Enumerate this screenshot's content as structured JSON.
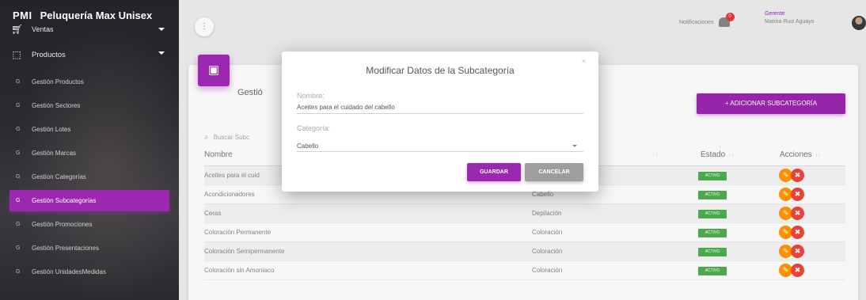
{
  "sidebar": {
    "logo": "PMI",
    "app_name": "Peluquería Max Unisex",
    "main_items": [
      {
        "label": "Ventas",
        "icon": "cart-icon"
      },
      {
        "label": "Productos",
        "icon": "basket-icon"
      }
    ],
    "sub_items": [
      {
        "marker": "G",
        "label": "Gestión Productos"
      },
      {
        "marker": "G",
        "label": "Gestión Sectores"
      },
      {
        "marker": "G",
        "label": "Gestión Lotes"
      },
      {
        "marker": "G",
        "label": "Gestión Marcas"
      },
      {
        "marker": "G",
        "label": "Gestion Categorías"
      },
      {
        "marker": "G",
        "label": "Gestión Subcategorías",
        "active": true
      },
      {
        "marker": "G",
        "label": "Gestión Promociones"
      },
      {
        "marker": "G",
        "label": "Gestión Presentaciones"
      },
      {
        "marker": "G",
        "label": "Gestión UnidadesMedidas"
      }
    ]
  },
  "topbar": {
    "menu_icon": "more-vert-icon",
    "notifications_label": "Notificaciones",
    "notifications_count": "0",
    "user_role": "Gerente",
    "user_name": "Marina Ruiz Aguayo"
  },
  "card": {
    "title": "Gestió",
    "add_button": "+ ADICIONAR SUBCATEGORÍA",
    "search_placeholder": "Buscar Subc"
  },
  "table": {
    "headers": {
      "name": "Nombre",
      "category": "↑↓",
      "status": "Estado",
      "actions": "Acciones"
    },
    "rows": [
      {
        "name": "Aceites para el cuid",
        "category": "",
        "status": "ACTIVO"
      },
      {
        "name": "Acondicionadores",
        "category": "Cabello",
        "status": "ACTIVO"
      },
      {
        "name": "Ceras",
        "category": "Depilación",
        "status": "ACTIVO"
      },
      {
        "name": "Coloración Permanente",
        "category": "Coloración",
        "status": "ACTIVO"
      },
      {
        "name": "Coloración Semipermanente",
        "category": "Coloración",
        "status": "ACTIVO"
      },
      {
        "name": "Coloración sin Amoníaco",
        "category": "Coloración",
        "status": "ACTIVO"
      }
    ]
  },
  "modal": {
    "title": "Modificar Datos de la Subcategoría",
    "close": "×",
    "name_label": "Nombre:",
    "name_value": "Aceites para el cuidado del cabello",
    "category_label": "Categoría:",
    "category_value": "Cabello",
    "save_button": "GUARDAR",
    "cancel_button": "CANCELAR"
  }
}
